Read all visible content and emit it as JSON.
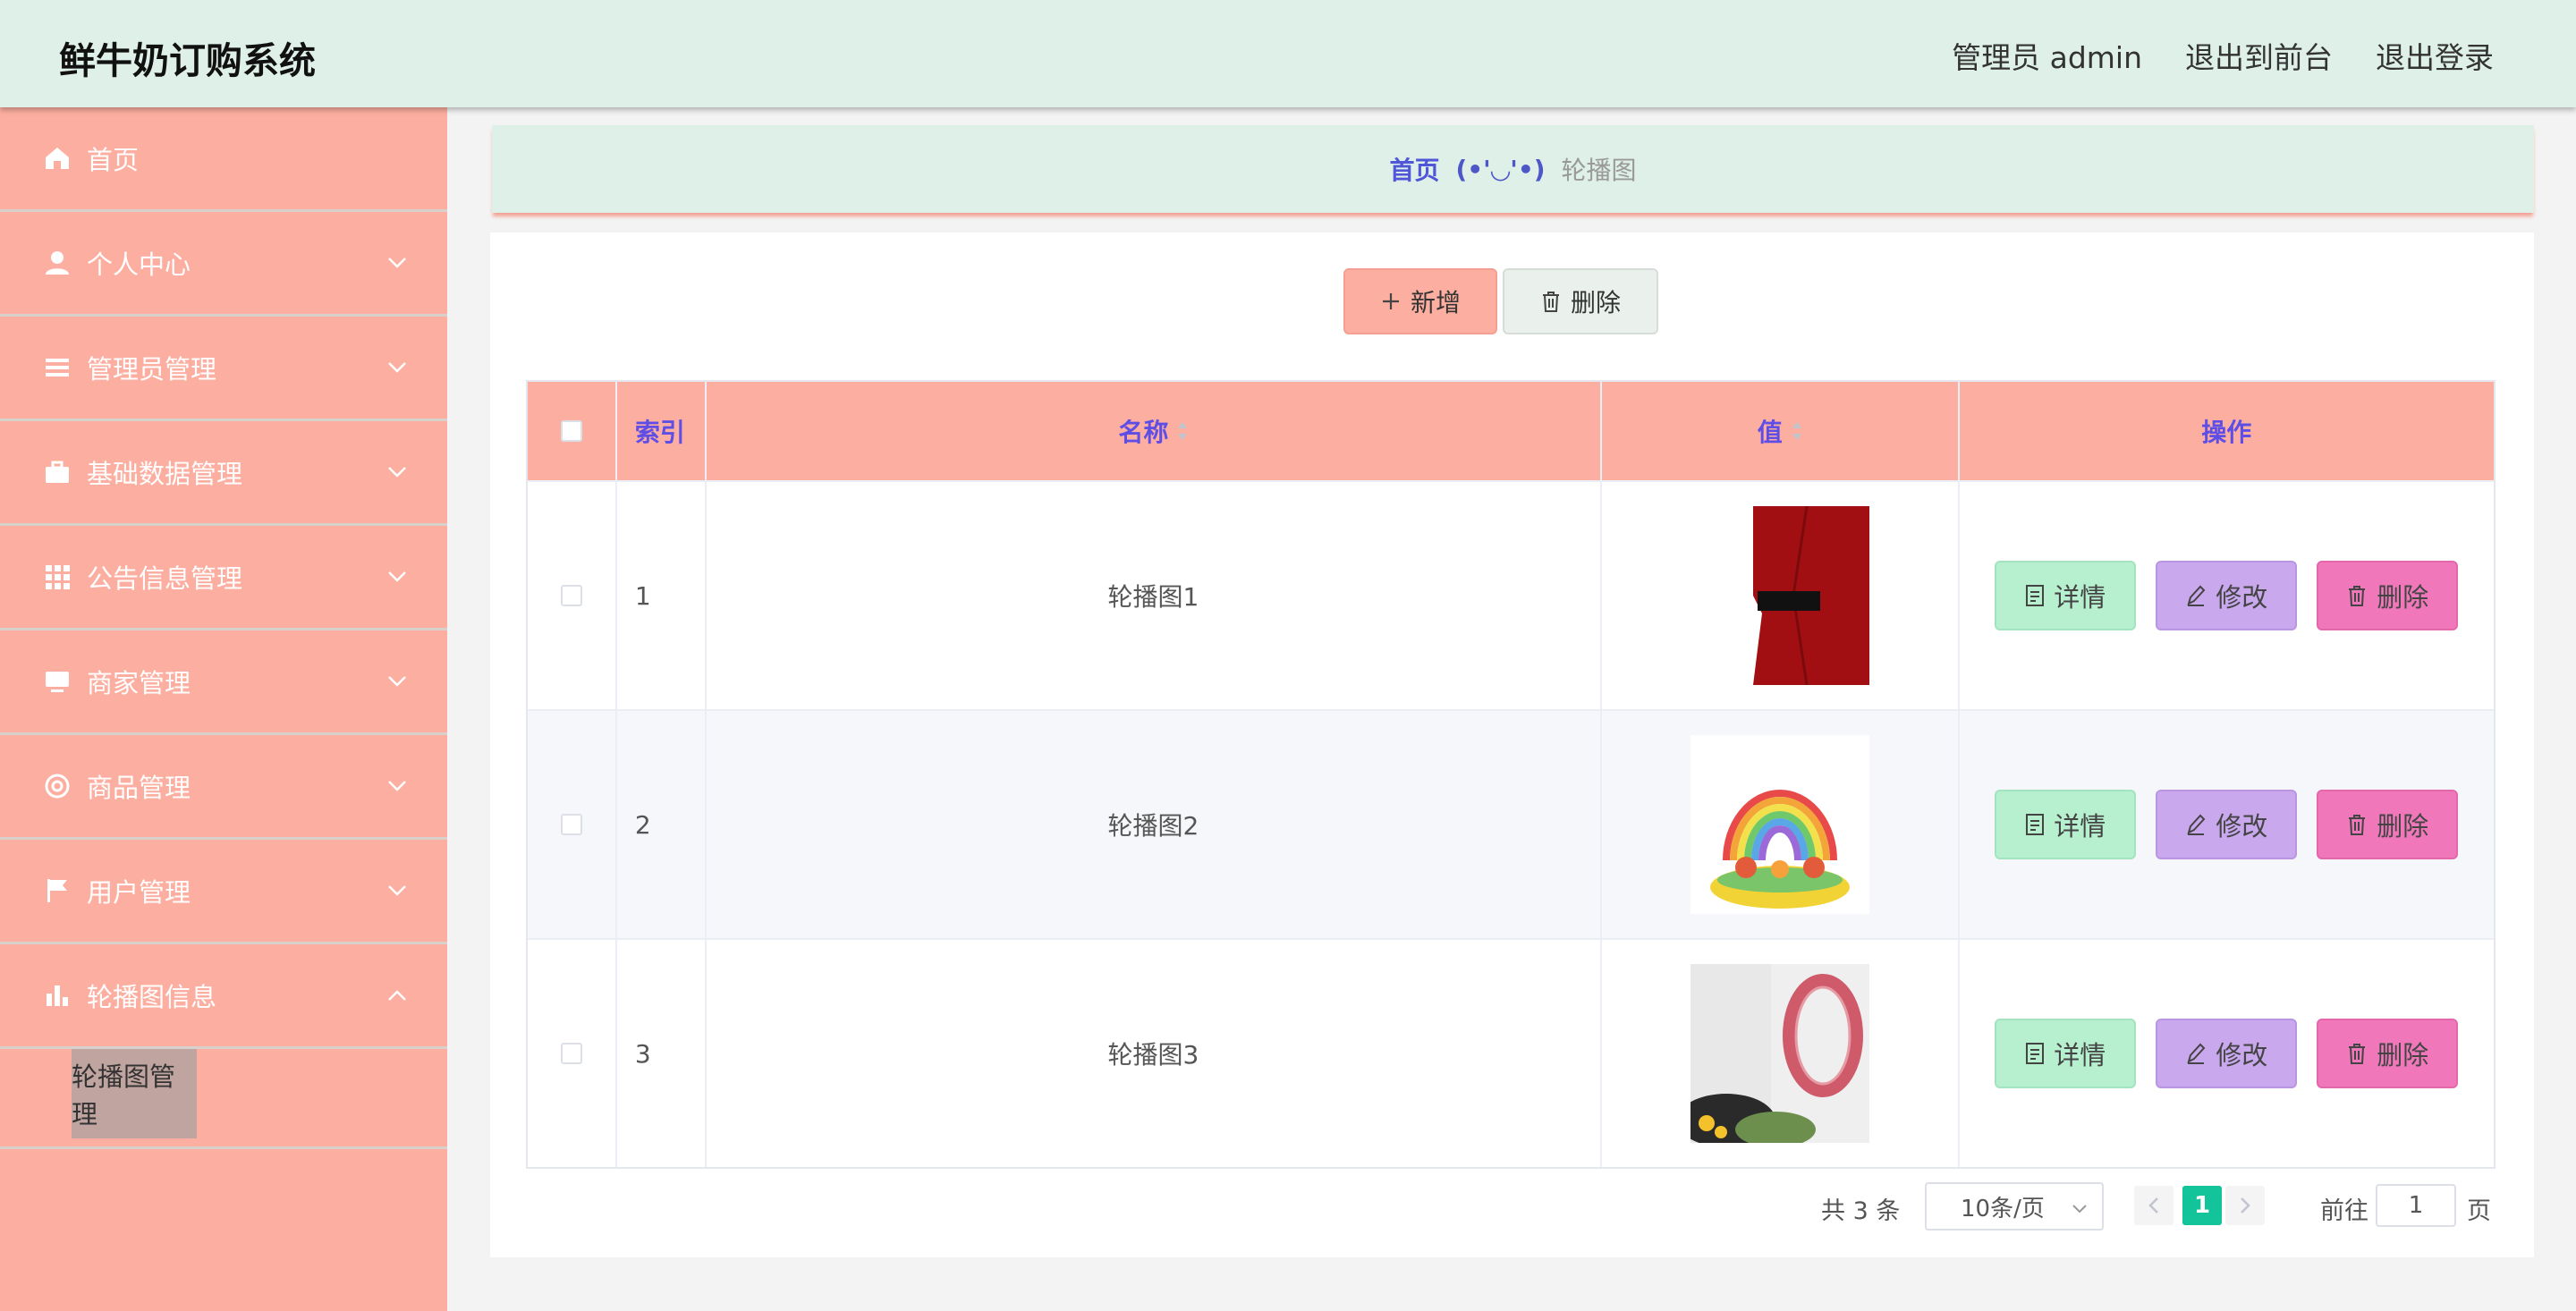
{
  "header": {
    "title": "鲜牛奶订购系统",
    "admin_label": "管理员 admin",
    "to_front": "退出到前台",
    "logout": "退出登录"
  },
  "sidebar": {
    "items": [
      {
        "label": "首页",
        "icon": "home-icon"
      },
      {
        "label": "个人中心",
        "icon": "user-icon"
      },
      {
        "label": "管理员管理",
        "icon": "list-icon"
      },
      {
        "label": "基础数据管理",
        "icon": "briefcase-icon"
      },
      {
        "label": "公告信息管理",
        "icon": "grid-icon"
      },
      {
        "label": "商家管理",
        "icon": "monitor-icon"
      },
      {
        "label": "商品管理",
        "icon": "lifebuoy-icon"
      },
      {
        "label": "用户管理",
        "icon": "flag-icon"
      },
      {
        "label": "轮播图信息",
        "icon": "bar-chart-icon"
      }
    ],
    "sub_item": "轮播图管理"
  },
  "breadcrumb": {
    "home": "首页",
    "separator": "(•'◡'•)",
    "current": "轮播图"
  },
  "toolbar": {
    "add_label": "新增",
    "delete_label": "删除"
  },
  "table": {
    "headers": {
      "index": "索引",
      "name": "名称",
      "value": "值",
      "actions": "操作"
    },
    "rows": [
      {
        "index": "1",
        "name": "轮播图1"
      },
      {
        "index": "2",
        "name": "轮播图2"
      },
      {
        "index": "3",
        "name": "轮播图3"
      }
    ],
    "actions": {
      "detail": "详情",
      "edit": "修改",
      "remove": "删除"
    }
  },
  "pagination": {
    "total": "共 3 条",
    "page_size": "10条/页",
    "current_page": "1",
    "goto_label": "前往",
    "goto_value": "1",
    "page_unit": "页"
  },
  "colors": {
    "header_bg": "#dff0e8",
    "sidebar_bg": "#fcaea0",
    "table_header_bg": "#fcaea0",
    "accent_text": "#5e4ee6",
    "detail_button": "#b7f0cf",
    "edit_button": "#c9a8ee",
    "remove_button": "#f078ba",
    "pager_active": "#13c39a"
  }
}
